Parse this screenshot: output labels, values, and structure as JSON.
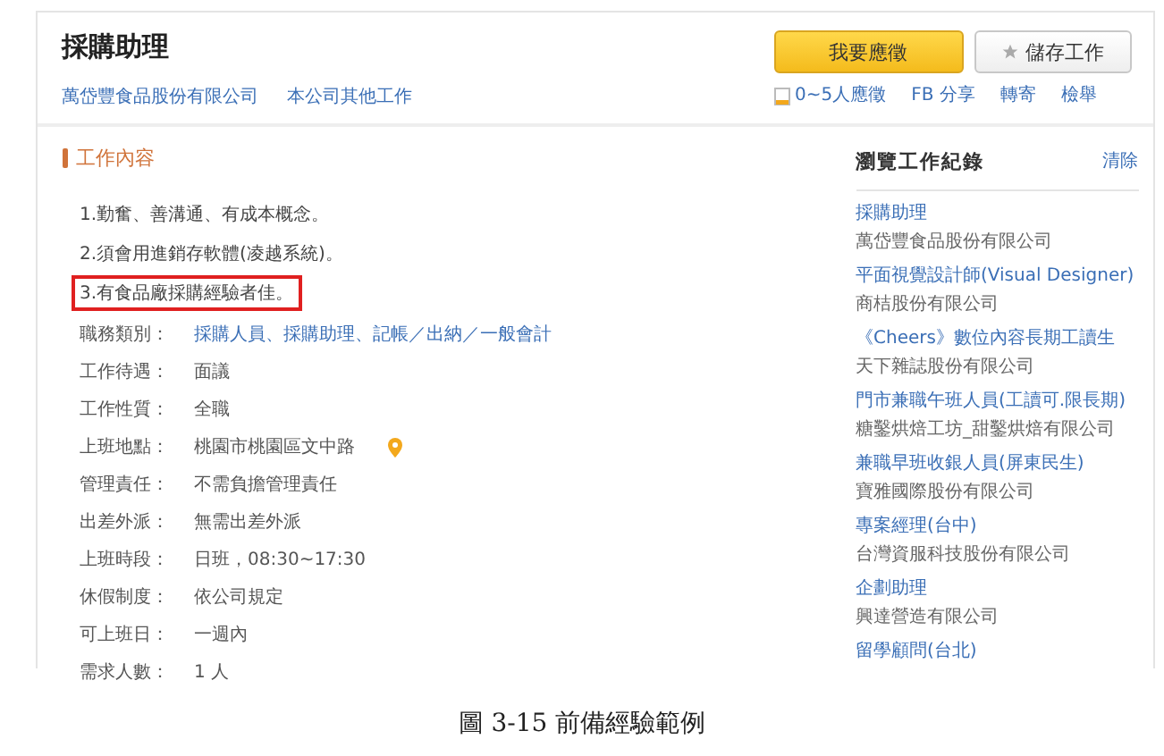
{
  "job": {
    "title": "採購助理",
    "company": "萬岱豐食品股份有限公司",
    "other_jobs": "本公司其他工作"
  },
  "actions": {
    "apply": "我要應徵",
    "save": "儲存工作",
    "applicants": "0~5人應徵",
    "share": "FB 分享",
    "forward": "轉寄",
    "report": "檢舉"
  },
  "section_title": "工作內容",
  "description": [
    {
      "text": "1.勤奮、善溝通、有成本概念。",
      "highlighted": false
    },
    {
      "text": "2.須會用進銷存軟體(凌越系統)。",
      "highlighted": false
    },
    {
      "text": "3.有食品廠採購經驗者佳。",
      "highlighted": true
    }
  ],
  "fields": [
    {
      "label": "職務類別：",
      "value": "採購人員、採購助理、記帳／出納／一般會計",
      "kind": "link"
    },
    {
      "label": "工作待遇：",
      "value": "面議",
      "kind": "text"
    },
    {
      "label": "工作性質：",
      "value": "全職",
      "kind": "text"
    },
    {
      "label": "上班地點：",
      "value": "桃園市桃園區文中路",
      "kind": "location"
    },
    {
      "label": "管理責任：",
      "value": "不需負擔管理責任",
      "kind": "text"
    },
    {
      "label": "出差外派：",
      "value": "無需出差外派",
      "kind": "text"
    },
    {
      "label": "上班時段：",
      "value": "日班，08:30~17:30",
      "kind": "text"
    },
    {
      "label": "休假制度：",
      "value": "依公司規定",
      "kind": "text"
    },
    {
      "label": "可上班日：",
      "value": "一週內",
      "kind": "text"
    },
    {
      "label": "需求人數：",
      "value": "1 人",
      "kind": "text"
    }
  ],
  "history": {
    "title": "瀏覽工作紀錄",
    "clear": "清除",
    "items": [
      {
        "job": "採購助理",
        "company": "萬岱豐食品股份有限公司"
      },
      {
        "job": "平面視覺設計師(Visual Designer)",
        "company": "商桔股份有限公司"
      },
      {
        "job": "《Cheers》數位內容長期工讀生",
        "company": "天下雜誌股份有限公司"
      },
      {
        "job": "門市兼職午班人員(工讀可.限長期)",
        "company": "糖鑿烘焙工坊_甜鑿烘焙有限公司"
      },
      {
        "job": "兼職早班收銀人員(屏東民生)",
        "company": "寶雅國際股份有限公司"
      },
      {
        "job": "專案經理(台中)",
        "company": "台灣資服科技股份有限公司"
      },
      {
        "job": "企劃助理",
        "company": "興達營造有限公司"
      },
      {
        "job": "留學顧問(台北)"
      }
    ]
  },
  "caption": "圖 3-15 前備經驗範例"
}
